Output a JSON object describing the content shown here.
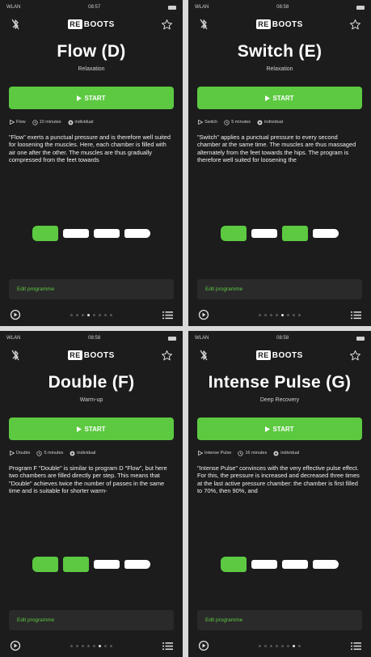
{
  "colors": {
    "accent": "#5cc941",
    "background": "#1c1c1c",
    "inactive": "#ffffff"
  },
  "logo": {
    "badge": "RE",
    "rest": "BOOTS"
  },
  "screens": [
    {
      "status": {
        "carrier": "WLAN",
        "time": "08:57"
      },
      "title": "Flow (D)",
      "subtitle": "Relaxation",
      "start_label": "START",
      "meta": {
        "program": "Flow",
        "duration": "10 minutes",
        "mode": "individual"
      },
      "description": "\"Flow\" exerts a punctual pressure and is therefore well suited for loosening the muscles. Here, each chamber is filled with air one after the other. The muscles are thus gradually compressed from the feet towards",
      "chambers": [
        true,
        false,
        false,
        false
      ],
      "edit_label": "Edit programme",
      "page_index": 3,
      "page_count": 8
    },
    {
      "status": {
        "carrier": "WLAN",
        "time": "08:58"
      },
      "title": "Switch (E)",
      "subtitle": "Relaxation",
      "start_label": "START",
      "meta": {
        "program": "Switch",
        "duration": "5 minutes",
        "mode": "individual"
      },
      "description": "\"Switch\" applies a punctual pressure to every second chamber at the same time. The muscles are thus massaged alternately from the feet towards the hips. The program is therefore well suited for loosening the",
      "chambers": [
        true,
        false,
        true,
        false
      ],
      "edit_label": "Edit programme",
      "page_index": 4,
      "page_count": 8
    },
    {
      "status": {
        "carrier": "WLAN",
        "time": "08:58"
      },
      "title": "Double (F)",
      "subtitle": "Warm-up",
      "start_label": "START",
      "meta": {
        "program": "Double",
        "duration": "5 minutes",
        "mode": "individual"
      },
      "description": "Program F \"Double\" is similar to program D \"Flow\", but here two chambers are filled directly per step. This means that \"Double\" achieves twice the number of passes in the same time and is suitable for shorter warm-",
      "chambers": [
        true,
        true,
        false,
        false
      ],
      "edit_label": "Edit programme",
      "page_index": 5,
      "page_count": 8
    },
    {
      "status": {
        "carrier": "WLAN",
        "time": "08:58"
      },
      "title": "Intense Pulse (G)",
      "subtitle": "Deep Recovery",
      "start_label": "START",
      "meta": {
        "program": "Intense Pulse",
        "duration": "16 minutes",
        "mode": "individual"
      },
      "description": "\"Intense Pulse\" convinces with the very effective pulse effect. For this, the pressure is increased and decreased three times at the last active pressure chamber: the chamber is first filled to 70%, then 90%, and",
      "chambers": [
        true,
        false,
        false,
        false
      ],
      "edit_label": "Edit programme",
      "page_index": 6,
      "page_count": 8
    }
  ]
}
